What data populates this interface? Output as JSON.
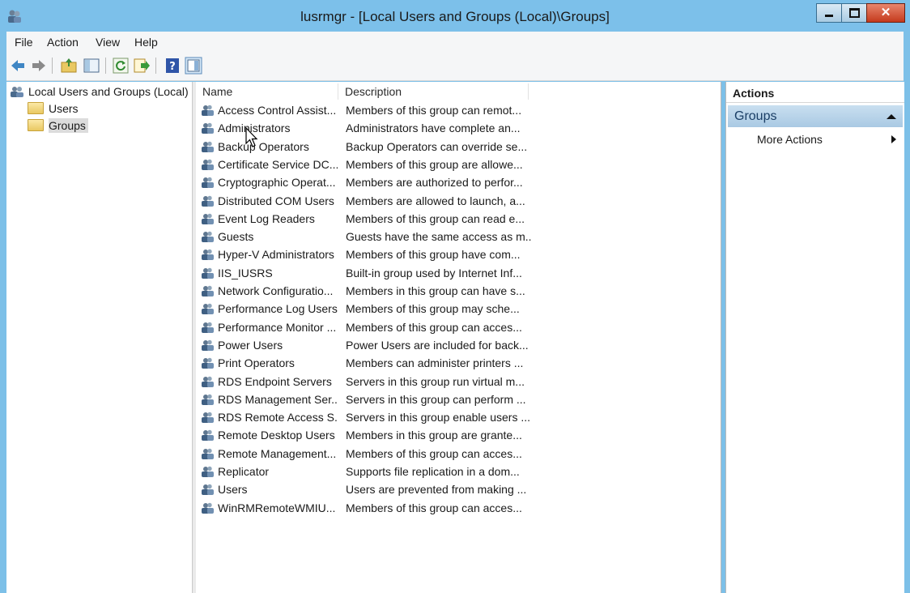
{
  "window": {
    "title": "lusrmgr - [Local Users and Groups (Local)\\Groups]"
  },
  "menu": [
    "File",
    "Action",
    "View",
    "Help"
  ],
  "tree": {
    "root": "Local Users and Groups (Local)",
    "children": [
      "Users",
      "Groups"
    ],
    "selected": "Groups"
  },
  "list": {
    "columns": [
      "Name",
      "Description"
    ],
    "rows": [
      {
        "name": "Access Control Assist...",
        "description": "Members of this group can remot..."
      },
      {
        "name": "Administrators",
        "description": "Administrators have complete an..."
      },
      {
        "name": "Backup Operators",
        "description": "Backup Operators can override se..."
      },
      {
        "name": "Certificate Service DC...",
        "description": "Members of this group are allowe..."
      },
      {
        "name": "Cryptographic Operat...",
        "description": "Members are authorized to perfor..."
      },
      {
        "name": "Distributed COM Users",
        "description": "Members are allowed to launch, a..."
      },
      {
        "name": "Event Log Readers",
        "description": "Members of this group can read e..."
      },
      {
        "name": "Guests",
        "description": "Guests have the same access as m..."
      },
      {
        "name": "Hyper-V Administrators",
        "description": "Members of this group have com..."
      },
      {
        "name": "IIS_IUSRS",
        "description": "Built-in group used by Internet Inf..."
      },
      {
        "name": "Network Configuratio...",
        "description": "Members in this group can have s..."
      },
      {
        "name": "Performance Log Users",
        "description": "Members of this group may sche..."
      },
      {
        "name": "Performance Monitor ...",
        "description": "Members of this group can acces..."
      },
      {
        "name": "Power Users",
        "description": "Power Users are included for back..."
      },
      {
        "name": "Print Operators",
        "description": "Members can administer printers ..."
      },
      {
        "name": "RDS Endpoint Servers",
        "description": "Servers in this group run virtual m..."
      },
      {
        "name": "RDS Management Ser...",
        "description": "Servers in this group can perform ..."
      },
      {
        "name": "RDS Remote Access S...",
        "description": "Servers in this group enable users ..."
      },
      {
        "name": "Remote Desktop Users",
        "description": "Members in this group are grante..."
      },
      {
        "name": "Remote Management...",
        "description": "Members of this group can acces..."
      },
      {
        "name": "Replicator",
        "description": "Supports file replication in a dom..."
      },
      {
        "name": "Users",
        "description": "Users are prevented from making ..."
      },
      {
        "name": "WinRMRemoteWMIU...",
        "description": "Members of this group can acces..."
      }
    ]
  },
  "actions": {
    "title": "Actions",
    "section": "Groups",
    "more": "More Actions"
  },
  "icons": {
    "app": "users-groups-icon",
    "back": "back-arrow-icon",
    "forward": "forward-arrow-icon",
    "up": "up-folder-icon",
    "show_hide_tree": "console-tree-icon",
    "refresh": "refresh-icon",
    "export": "export-list-icon",
    "help": "help-icon",
    "show_hide_action": "action-pane-icon",
    "group": "group-icon",
    "folder": "folder-icon"
  },
  "colors": {
    "titlebar": "#7cc0ea",
    "close": "#c53a1c",
    "actions_section": "#a9c9e3"
  }
}
